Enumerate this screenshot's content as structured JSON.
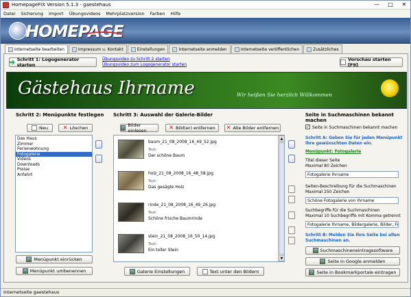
{
  "window": {
    "title": "HomepageFIX Version 5.1.3 - gaestehaus",
    "min": "—",
    "max": "□",
    "close": "✕"
  },
  "menu": [
    "Datei",
    "Sicherung",
    "Import",
    "Übungsvideos",
    "Mehrplatzversion",
    "Farben",
    "Hilfe"
  ],
  "banner": {
    "logo_text": "HOMEPAGE"
  },
  "tabs": [
    "Internetseite bearbeiten",
    "Impressum u. Kontakt",
    "Einstellungen",
    "Internetseite anmelden",
    "Internetseite veröffentlichen",
    "Zusätzliches"
  ],
  "toolbar": {
    "step1_label": "Schritt 1: Logogenerator starten",
    "video1": "Übungsvideo zu Schritt 2 starten",
    "video2": "Übungsvideo zum Logogenerator starten",
    "preview_label": "Vorschau starten [F9]"
  },
  "hero": {
    "title": "Gästehaus Ihrname",
    "subtitle": "Wir heißen Sie herzlich Willkommen"
  },
  "step2": {
    "header": "Schritt 2: Menüpunkte festlegen",
    "new_label": "Neu",
    "delete_label": "Löschen",
    "items": [
      "Das Haus",
      "Zimmer",
      "Ferienwohnung",
      "Fotogalerie",
      "Videos",
      "Downloads",
      "Preise",
      "Anfahrt"
    ],
    "selected_index": 3,
    "indent_label": "Menüpunkt einrücken",
    "rename_label": "Menüpunkt umbenennen"
  },
  "step3": {
    "header": "Schritt 3: Auswahl der Galerie-Bilder",
    "load_label": "Bilder einlesen",
    "remove_label": "Bild(er) entfernen",
    "remove_all_label": "Alle Bilder entfernen",
    "text_label": "Text:",
    "images": [
      {
        "file": "baum_21_08_2008_16_49_52.jpg",
        "text": "Der schöne Baum"
      },
      {
        "file": "holz_21_08_2008_16_48_58.jpg",
        "text": "Das gesägte Holz"
      },
      {
        "file": "rinde_21_08_2008_16_49_26.jpg",
        "text": "Schöne frische Baumrinde"
      },
      {
        "file": "stein_21_08_2008_16_50_14.jpg",
        "text": "Ein toller Stein"
      }
    ],
    "settings_label": "Galerie Einstellungen",
    "text_under_label": "Text unter den Bildern"
  },
  "seo": {
    "header": "Seite in Suchmaschinen bekannt machen",
    "checkbox_label": "Seite in Suchmaschinen bekannt machen",
    "step_a": "Schritt A: Geben Sie für jeden Menüpunkt Ihre gewünschten Daten ein.",
    "menupunkt_label": "Menüpunkt: Fotogalerie",
    "title_label": "Titel dieser Seite",
    "title_max": "Maximal 80 Zeichen",
    "title_value": "Fotogalerie Ihrname",
    "desc_label": "Seiten-Beschreibung für die Suchmaschinen",
    "desc_max": "Maximal 250 Zeichen",
    "desc_value": "Schöne Fotogalerie von Ihrname",
    "kw_label": "Suchbegriffe für die Suchmaschinen",
    "kw_max": "Maximal 10 Suchbegriffe mit Komma getrennt",
    "kw_value": "Fotogalerie Ihrname, Bildergalerie, Bilder, Fotos",
    "step_b": "Schritt B: Melden Sie Ihre Seite bei allen Suchmaschinen an.",
    "btn_software": "Suchmaschineneintragssoftware",
    "btn_google": "Seite in Google anmelden",
    "btn_bookmark": "Seite in Bookmarkportale eintragen"
  },
  "status": "Internetseite gaestehaus"
}
